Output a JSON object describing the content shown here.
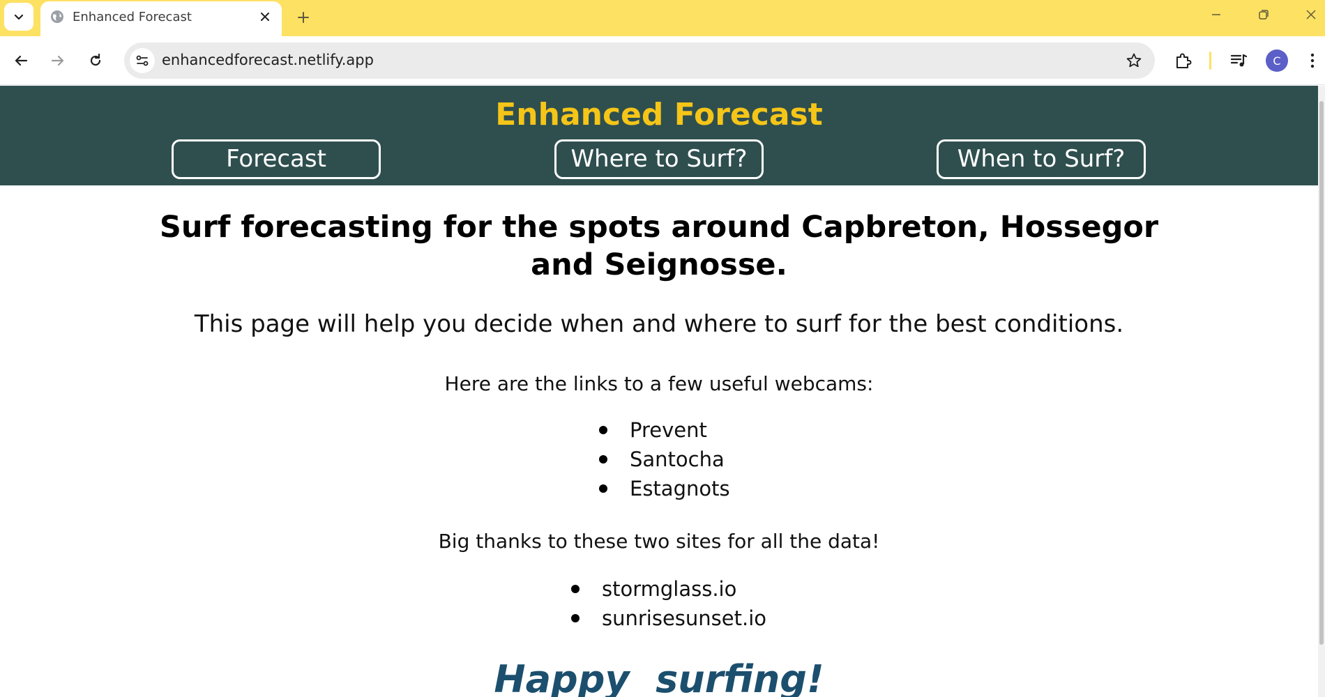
{
  "browser": {
    "tab": {
      "title": "Enhanced Forecast",
      "favicon": "globe-icon"
    },
    "address_bar": {
      "url": "enhancedforecast.netlify.app"
    },
    "profile_initial": "C",
    "accent_color": "#fde163"
  },
  "site": {
    "title": "Enhanced Forecast",
    "title_color": "#f5c518",
    "header_color": "#2f4f4f",
    "nav": [
      {
        "label": "Forecast"
      },
      {
        "label": "Where to Surf?"
      },
      {
        "label": "When to Surf?"
      }
    ]
  },
  "main": {
    "heading": "Surf forecasting for the spots around Capbreton, Hossegor and Seignosse.",
    "intro": "This page will help you decide when and where to surf for the best conditions.",
    "webcams_intro": "Here are the links to a few useful webcams:",
    "webcams": [
      {
        "label": "Prevent"
      },
      {
        "label": "Santocha"
      },
      {
        "label": "Estagnots"
      }
    ],
    "thanks_intro": "Big thanks to these two sites for all the data!",
    "sources": [
      {
        "label": "stormglass.io"
      },
      {
        "label": "sunrisesunset.io"
      }
    ],
    "closing": "Happy  surfing!"
  }
}
